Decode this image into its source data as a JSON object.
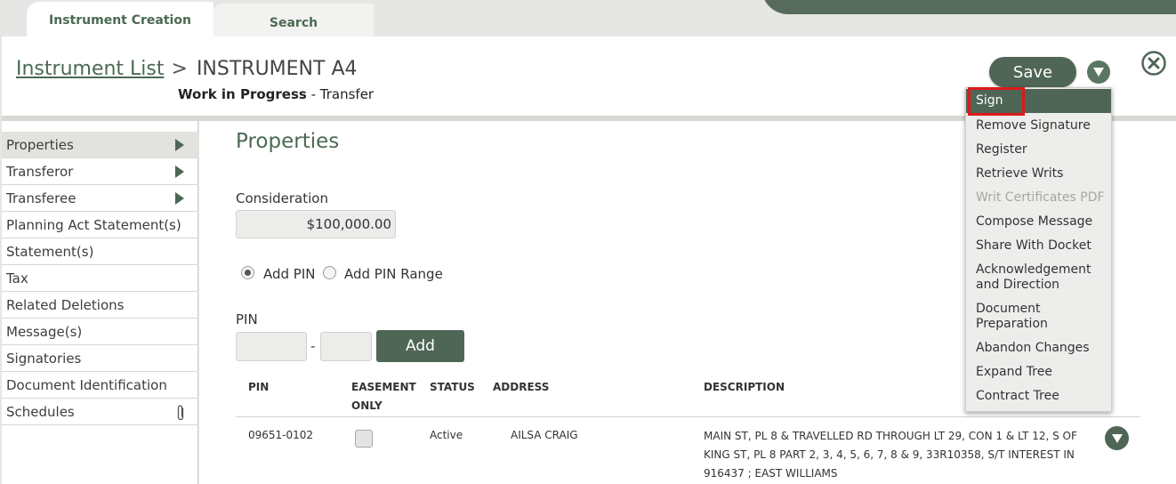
{
  "tabs": [
    {
      "label": "Instrument Creation",
      "active": true
    },
    {
      "label": "Search",
      "active": false
    }
  ],
  "header": {
    "breadcrumb_link": "Instrument List",
    "breadcrumb_sep": ">",
    "instrument_name": "INSTRUMENT A4",
    "status": "Work in Progress",
    "status_sep": " - ",
    "type": "Transfer",
    "save_label": "Save"
  },
  "sidebar": {
    "items": [
      {
        "label": "Properties",
        "arrow": true,
        "active": true
      },
      {
        "label": "Transferor",
        "arrow": true
      },
      {
        "label": "Transferee",
        "arrow": true
      },
      {
        "label": "Planning Act Statement(s)"
      },
      {
        "label": "Statement(s)"
      },
      {
        "label": "Tax"
      },
      {
        "label": "Related Deletions"
      },
      {
        "label": "Message(s)"
      },
      {
        "label": "Signatories"
      },
      {
        "label": "Document Identification"
      },
      {
        "label": "Schedules",
        "icon": "paperclip-icon"
      }
    ]
  },
  "main": {
    "section_title": "Properties",
    "consideration_label": "Consideration",
    "consideration_value": "$100,000.00",
    "radio_add_pin": "Add PIN",
    "radio_add_pin_range": "Add PIN Range",
    "radio_selected": "Add PIN",
    "pin_label": "PIN",
    "pin_separator": "-",
    "add_label": "Add",
    "table": {
      "columns": [
        "PIN",
        "EASEMENT",
        "ONLY",
        "STATUS",
        "ADDRESS",
        "DESCRIPTION"
      ],
      "rows": [
        {
          "pin": "09651-0102",
          "easement_only": false,
          "status": "Active",
          "address": "AILSA CRAIG",
          "description_lines": [
            "MAIN ST, PL 8 & TRAVELLED RD THROUGH LT 29, CON 1 & LT 12, S OF",
            "KING ST, PL 8 PART 2, 3, 4, 5, 6, 7, 8 & 9, 33R10358, S/T INTEREST IN",
            "916437 ; EAST WILLIAMS"
          ]
        }
      ]
    }
  },
  "menu": {
    "items": [
      {
        "label": "Sign",
        "highlighted": true
      },
      {
        "label": "Remove Signature"
      },
      {
        "label": "Register"
      },
      {
        "label": "Retrieve Writs"
      },
      {
        "label": "Writ Certificates PDF",
        "disabled": true
      },
      {
        "label": "Compose Message"
      },
      {
        "label": "Share With Docket"
      },
      {
        "label": "Acknowledgement",
        "label2": "and Direction"
      },
      {
        "label": "Document",
        "label2": "Preparation"
      },
      {
        "label": "Abandon Changes"
      },
      {
        "label": "Expand Tree"
      },
      {
        "label": "Contract Tree"
      }
    ]
  },
  "colors": {
    "brand_green": "#4f6656",
    "highlight_red": "#dd1a1a"
  },
  "icons": [
    "close-icon",
    "chevron-down-icon",
    "paperclip-icon",
    "triangle-right-icon"
  ]
}
